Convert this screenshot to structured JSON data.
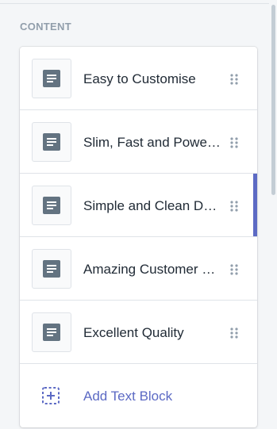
{
  "section": {
    "title": "CONTENT"
  },
  "blocks": [
    {
      "label": "Easy to Customise",
      "icon": "text-block-icon",
      "selected": false
    },
    {
      "label": "Slim, Fast and Powerful",
      "icon": "text-block-icon",
      "selected": false
    },
    {
      "label": "Simple and Clean Design",
      "icon": "text-block-icon",
      "selected": true
    },
    {
      "label": "Amazing Customer Support",
      "icon": "text-block-icon",
      "selected": false
    },
    {
      "label": "Excellent Quality",
      "icon": "text-block-icon",
      "selected": false
    }
  ],
  "add_block": {
    "label": "Add Text Block",
    "icon": "add-block-icon"
  },
  "colors": {
    "accent": "#5c6ac4",
    "icon": "#637381",
    "text": "#212b36",
    "muted": "#919eab"
  }
}
